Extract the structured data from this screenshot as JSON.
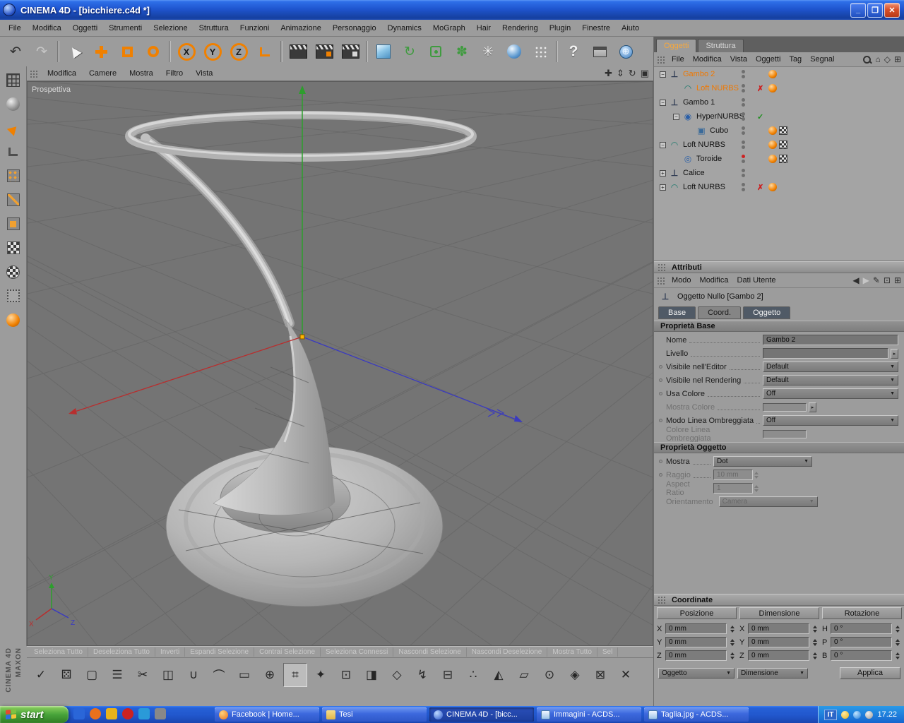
{
  "window": {
    "title": "CINEMA 4D - [bicchiere.c4d *]",
    "controls": {
      "minimize": "_",
      "maximize": "❐",
      "close": "✕"
    }
  },
  "menubar": {
    "items": [
      "File",
      "Modifica",
      "Oggetti",
      "Strumenti",
      "Selezione",
      "Struttura",
      "Funzioni",
      "Animazione",
      "Personaggio",
      "Dynamics",
      "MoGraph",
      "Hair",
      "Rendering",
      "Plugin",
      "Finestre",
      "Aiuto"
    ]
  },
  "toolbar": {
    "axis": [
      "X",
      "Y",
      "Z"
    ],
    "help": "?"
  },
  "viewport": {
    "menu": [
      "Modifica",
      "Camere",
      "Mostra",
      "Filtro",
      "Vista"
    ],
    "label": "Prospettiva",
    "triad": {
      "x": "X",
      "y": "Y",
      "z": "Z"
    }
  },
  "object_manager": {
    "tabs": [
      {
        "label": "Oggetti"
      },
      {
        "label": "Struttura"
      }
    ],
    "menu": [
      "File",
      "Modifica",
      "Vista",
      "Oggetti",
      "Tag",
      "Segnal"
    ],
    "rows": [
      {
        "label": "Gambo 2"
      },
      {
        "label": "Loft NURBS"
      },
      {
        "label": "Gambo 1"
      },
      {
        "label": "HyperNURBS"
      },
      {
        "label": "Cubo"
      },
      {
        "label": "Loft NURBS"
      },
      {
        "label": "Toroide"
      },
      {
        "label": "Calice"
      },
      {
        "label": "Loft NURBS"
      }
    ]
  },
  "attributes": {
    "panel_title": "Attributi",
    "menu": [
      "Modo",
      "Modifica",
      "Dati Utente"
    ],
    "object_label": "Oggetto Nullo [Gambo 2]",
    "tabs": [
      "Base",
      "Coord.",
      "Oggetto"
    ],
    "base_section": {
      "title": "Proprietà Base",
      "rows": [
        {
          "label": "Nome",
          "value": "Gambo 2"
        },
        {
          "label": "Livello",
          "value": ""
        },
        {
          "label": "Visibile nell'Editor",
          "value": "Default"
        },
        {
          "label": "Visibile nel Rendering",
          "value": "Default"
        },
        {
          "label": "Usa Colore",
          "value": "Off"
        },
        {
          "label": "Mostra Colore",
          "value": ""
        },
        {
          "label": "Modo Linea Ombreggiata",
          "value": "Off"
        },
        {
          "label": "Colore Linea Ombreggiata",
          "value": ""
        }
      ]
    },
    "object_section": {
      "title": "Proprietà Oggetto",
      "rows": [
        {
          "label": "Mostra",
          "value": "Dot"
        },
        {
          "label": "Raggio",
          "value": "10 mm"
        },
        {
          "label": "Aspect Ratio",
          "value": "1"
        },
        {
          "label": "Orientamento",
          "value": "Camera"
        }
      ]
    }
  },
  "coordinates": {
    "panel_title": "Coordinate",
    "columns": [
      "Posizione",
      "Dimensione",
      "Rotazione"
    ],
    "position": [
      {
        "axis": "X",
        "value": "0 mm"
      },
      {
        "axis": "Y",
        "value": "0 mm"
      },
      {
        "axis": "Z",
        "value": "0 mm"
      }
    ],
    "size": [
      {
        "axis": "X",
        "value": "0 mm"
      },
      {
        "axis": "Y",
        "value": "0 mm"
      },
      {
        "axis": "Z",
        "value": "0 mm"
      }
    ],
    "rotation": [
      {
        "axis": "H",
        "value": "0 °"
      },
      {
        "axis": "P",
        "value": "0 °"
      },
      {
        "axis": "B",
        "value": "0 °"
      }
    ],
    "mode_left": "Oggetto",
    "mode_right": "Dimensione",
    "apply": "Applica"
  },
  "selection_bar": {
    "items": [
      "Seleziona Tutto",
      "Deseleziona Tutto",
      "Inverti",
      "Espandi Selezione",
      "Contrai Selezione",
      "Seleziona Connessi",
      "Nascondi Selezione",
      "Nascondi Deselezione",
      "Mostra Tutto",
      "Sel"
    ]
  },
  "brand": {
    "maxon": "MAXON",
    "cinema": "CINEMA 4D"
  },
  "taskbar": {
    "start": "start",
    "tasks": [
      {
        "label": "Facebook | Home..."
      },
      {
        "label": "Tesi"
      },
      {
        "label": "CINEMA 4D - [bicc..."
      },
      {
        "label": "Immagini - ACDS..."
      },
      {
        "label": "Taglia.jpg - ACDS..."
      }
    ],
    "tray": {
      "lang": "IT",
      "time": "17.22"
    }
  },
  "colors": {
    "accent_orange": "#f08000",
    "selected_text": "#f07800",
    "xp_blue": "#245edb",
    "disabled_red": "#cc1f1f",
    "enabled_green": "#1f8f1f"
  }
}
